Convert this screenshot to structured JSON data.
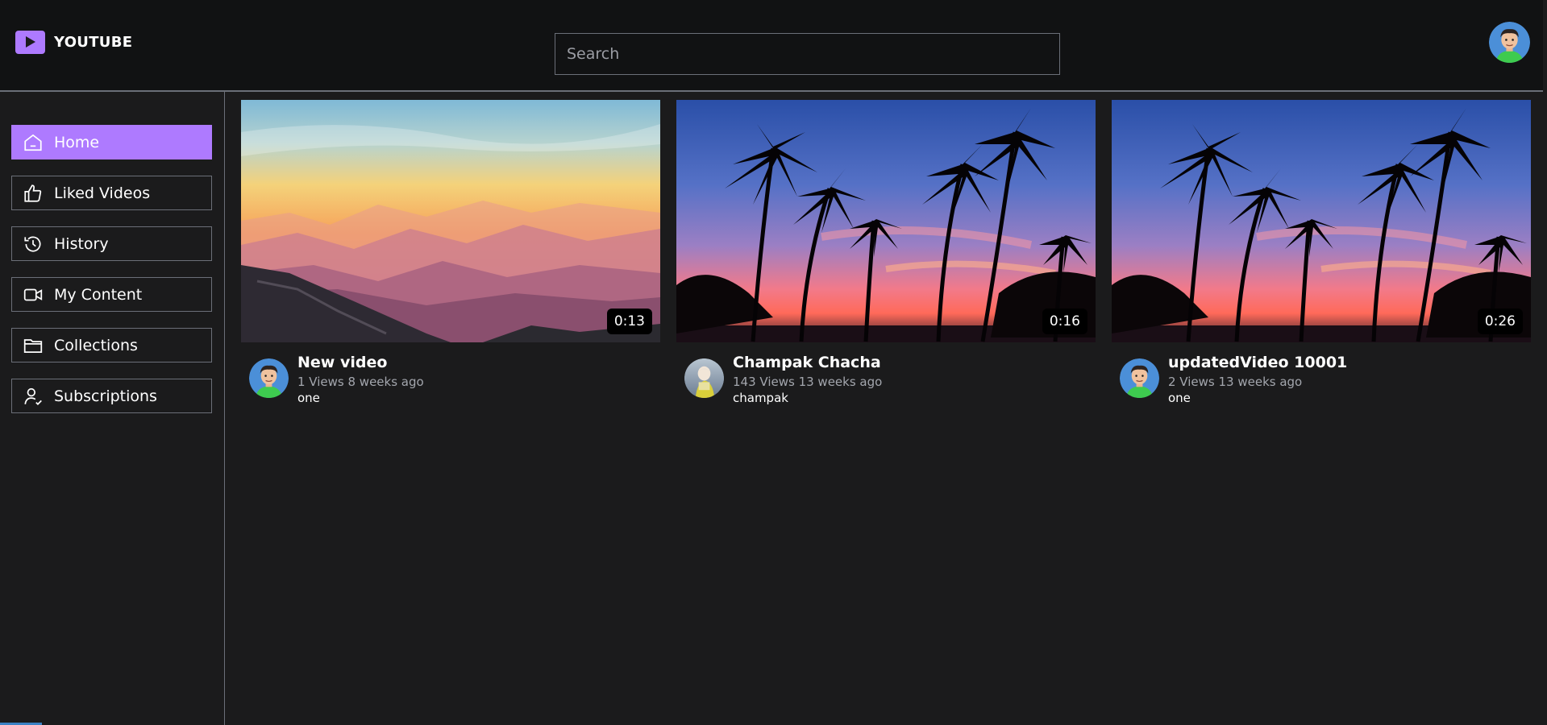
{
  "app": {
    "logo_text": "YOUTUBE",
    "brand_color": "#ae7aff",
    "logo_icon": "play-icon"
  },
  "search": {
    "placeholder": "Search",
    "value": ""
  },
  "user": {
    "avatar_icon": "user-avatar"
  },
  "sidebar": {
    "items": [
      {
        "label": "Home",
        "icon": "home-icon",
        "active": true
      },
      {
        "label": "Liked Videos",
        "icon": "thumbs-up-icon",
        "active": false
      },
      {
        "label": "History",
        "icon": "history-icon",
        "active": false
      },
      {
        "label": "My Content",
        "icon": "video-camera-icon",
        "active": false
      },
      {
        "label": "Collections",
        "icon": "folder-icon",
        "active": false
      },
      {
        "label": "Subscriptions",
        "icon": "user-check-icon",
        "active": false
      }
    ]
  },
  "videos": [
    {
      "title": "New video",
      "stats": "1 Views 8 weeks ago",
      "channel": "one",
      "duration": "0:13",
      "thumbnail": "mountain-sunset",
      "avatar": "cartoon-boy"
    },
    {
      "title": "Champak Chacha",
      "stats": "143 Views 13 weeks ago",
      "channel": "champak",
      "duration": "0:16",
      "thumbnail": "palm-sunset",
      "avatar": "champak"
    },
    {
      "title": "updatedVideo 10001",
      "stats": "2 Views 13 weeks ago",
      "channel": "one",
      "duration": "0:26",
      "thumbnail": "palm-sunset",
      "avatar": "cartoon-boy"
    }
  ]
}
